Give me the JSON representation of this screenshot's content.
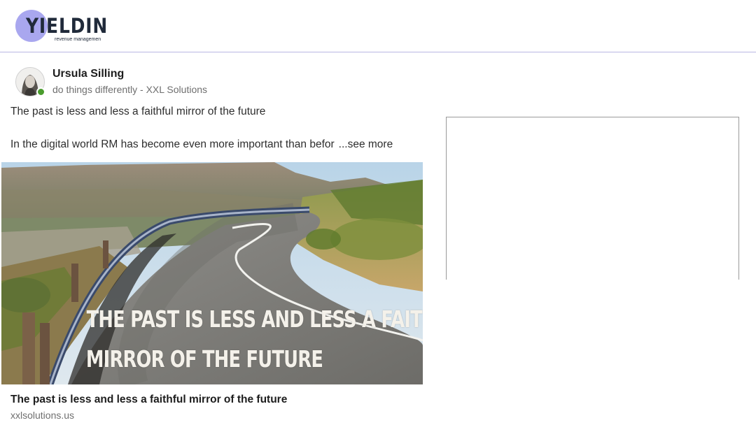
{
  "header": {
    "logo_text": "YIELDIN",
    "logo_subtitle": "revenue managemen",
    "brand_color": "#a9a7ef"
  },
  "post": {
    "author": {
      "name": "Ursula Silling",
      "headline": "do things differently - XXL Solutions",
      "status": "online"
    },
    "text_line1": "The past is less and less a faithful mirror of the future",
    "text_line2": "In the digital world RM has become even more important than befor",
    "see_more_label": "...see more",
    "image": {
      "overlay_line1": "THE PAST IS LESS AND LESS A FAITHFUL",
      "overlay_line2": "MIRROR OF THE FUTURE"
    },
    "link": {
      "title": "The past is less and less a faithful mirror of the future",
      "domain": "xxlsolutions.us"
    }
  },
  "colors": {
    "divider": "#b9b6e4",
    "presence_online": "#4a9c2d"
  }
}
